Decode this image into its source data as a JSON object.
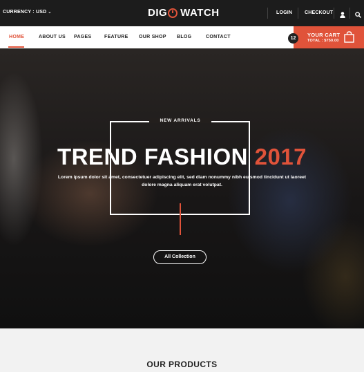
{
  "topbar": {
    "currency_label": "CURRENCY : USD",
    "logo_left": "DIG",
    "logo_right": "WATCH",
    "login": "LOGIN",
    "checkout": "CHECKOUT"
  },
  "nav": {
    "items": [
      {
        "label": "HOME"
      },
      {
        "label": "ABOUT US"
      },
      {
        "label": "PAGES"
      },
      {
        "label": "FEATURE"
      },
      {
        "label": "OUR SHOP"
      },
      {
        "label": "BLOG"
      },
      {
        "label": "CONTACT"
      }
    ]
  },
  "cart": {
    "count": "12",
    "title": "YOUR CART",
    "total": "TOTAL : $750.00"
  },
  "hero": {
    "tagline": "NEW ARRIVALS",
    "title": "TREND FASHION",
    "year": "2017",
    "description": "Lorem ipsum dolor sit amet, consectetuer adipiscing elit, sed diam nonummy nibh euismod tincidunt ut laoreet dolore magna aliquam erat volutpat.",
    "button": "All Collection"
  },
  "products": {
    "title": "OUR PRODUCTS"
  },
  "colors": {
    "accent": "#e0533a",
    "topbar": "#1c1c1c"
  }
}
